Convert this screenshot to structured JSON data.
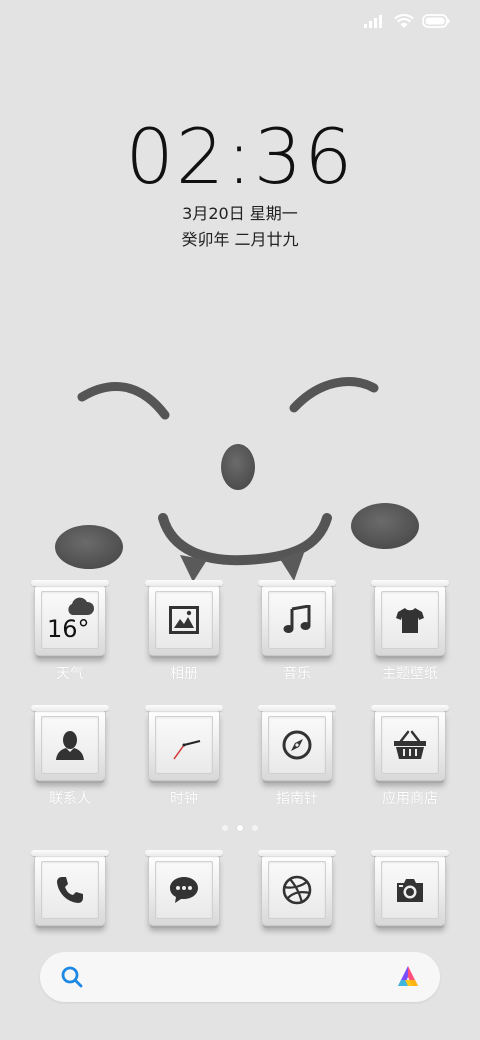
{
  "status_bar": {
    "signal_icon": "signal-bars-icon",
    "wifi_icon": "wifi-icon",
    "battery_icon": "battery-icon"
  },
  "lock": {
    "time": "02:36",
    "date": "3月20日 星期一",
    "lunar": "癸卯年 二月廿九"
  },
  "apps_row1": [
    {
      "label": "天气",
      "icon": "weather-icon",
      "temp": "16°"
    },
    {
      "label": "相册",
      "icon": "gallery-icon"
    },
    {
      "label": "音乐",
      "icon": "music-note-icon"
    },
    {
      "label": "主题壁纸",
      "icon": "tshirt-icon"
    }
  ],
  "apps_row2": [
    {
      "label": "联系人",
      "icon": "contact-person-icon"
    },
    {
      "label": "时钟",
      "icon": "clock-hands-icon"
    },
    {
      "label": "指南针",
      "icon": "compass-icon"
    },
    {
      "label": "应用商店",
      "icon": "shopping-basket-icon"
    }
  ],
  "dock": [
    {
      "icon": "phone-icon"
    },
    {
      "icon": "message-bubble-icon"
    },
    {
      "icon": "dribbble-ball-icon"
    },
    {
      "icon": "camera-icon"
    }
  ],
  "page_indicator": {
    "count": 3,
    "active": 2
  },
  "search": {
    "search_icon": "search-icon",
    "assistant_icon": "assistant-icon",
    "accent": "#1e88e5"
  }
}
